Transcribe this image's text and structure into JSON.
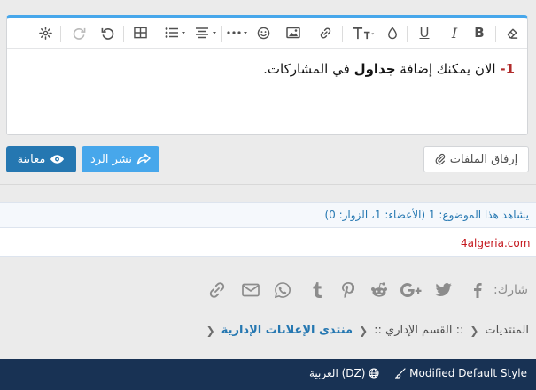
{
  "editor": {
    "toolbar": {
      "icons": [
        "eraser-icon",
        "bold-icon",
        "italic-icon",
        "underline-icon",
        "color-icon",
        "text-size-icon",
        "link-icon",
        "image-icon",
        "smilie-icon",
        "more-icon",
        "align-icon",
        "list-icon",
        "table-icon",
        "undo-icon",
        "redo-icon",
        "settings-icon"
      ],
      "bold": "B",
      "italic": "I",
      "underline": "U"
    },
    "content": {
      "number": "1-",
      "text_before": " الان يمكنك إضافة ",
      "bold_word": "جداول",
      "text_after": " في المشاركات."
    }
  },
  "buttons": {
    "attach": "إرفاق الملفات",
    "post_reply": "نشر الرد",
    "preview": "معاينة"
  },
  "viewers": {
    "text": "يشاهد هذا الموضوع: 1 (الأعضاء: 1، الزوار: 0)"
  },
  "sponsor": {
    "link": "4algeria.com"
  },
  "share": {
    "label": "شارك:",
    "networks": [
      "facebook-icon",
      "twitter-icon",
      "google-plus-icon",
      "reddit-icon",
      "pinterest-icon",
      "tumblr-icon",
      "whatsapp-icon",
      "email-icon",
      "link-icon"
    ]
  },
  "breadcrumb": {
    "items": [
      "المنتديات",
      ":: القسم الإداري ::",
      "منتدى الإعلانات الإدارية"
    ]
  },
  "footer": {
    "style": "Modified Default Style",
    "language": "العربية (DZ)"
  },
  "colors": {
    "accent": "#47a7eb",
    "primary": "#2577b1",
    "footer_bg": "#183254",
    "sponsor_link": "#c4161c",
    "number_red": "#b12b2b"
  }
}
